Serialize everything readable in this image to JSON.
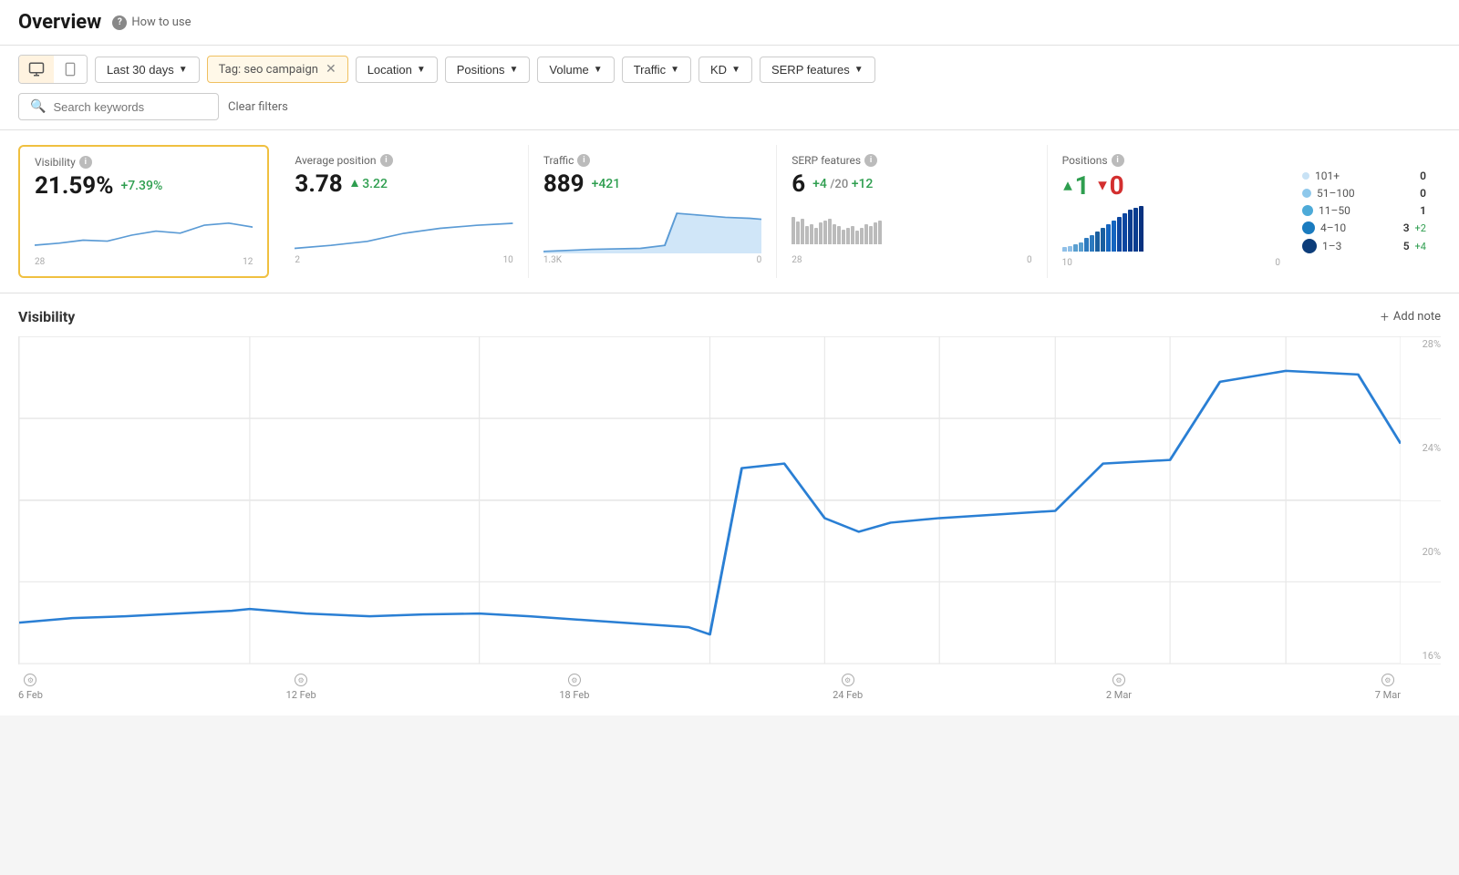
{
  "header": {
    "title": "Overview",
    "help_label": "How to use"
  },
  "toolbar": {
    "date_filter": "Last 30 days",
    "tag_filter": "Tag: seo campaign",
    "location_filter": "Location",
    "positions_filter": "Positions",
    "volume_filter": "Volume",
    "traffic_filter": "Traffic",
    "kd_filter": "KD",
    "serp_filter": "SERP features",
    "search_placeholder": "Search keywords",
    "clear_filters": "Clear filters"
  },
  "metrics": {
    "visibility": {
      "label": "Visibility",
      "value": "21.59%",
      "delta": "+7.39%",
      "y_max": "28",
      "y_min": "12"
    },
    "avg_position": {
      "label": "Average position",
      "value": "3.78",
      "delta": "3.22",
      "y_max": "2",
      "y_min": "10"
    },
    "traffic": {
      "label": "Traffic",
      "value": "889",
      "delta": "+421",
      "y_max": "1.3K",
      "y_min": "0"
    },
    "serp_features": {
      "label": "SERP features",
      "value": "6",
      "delta_plus": "+4",
      "total": "/20",
      "delta_new": "+12",
      "y_max": "28",
      "y_min": "0"
    },
    "positions": {
      "label": "Positions",
      "up": "1",
      "down": "0",
      "y_max": "10",
      "y_min": "0"
    }
  },
  "positions_legend": [
    {
      "range": "101+",
      "count": "0",
      "delta": "",
      "color": "#d0e8f8",
      "size": 8
    },
    {
      "range": "51–100",
      "count": "0",
      "delta": "",
      "color": "#a0cff0",
      "size": 10
    },
    {
      "range": "11–50",
      "count": "1",
      "delta": "",
      "color": "#60aadd",
      "size": 12
    },
    {
      "range": "4–10",
      "count": "3",
      "delta": "+2",
      "delta_color": "#2e9e4f",
      "color": "#1e80c8",
      "size": 14
    },
    {
      "range": "1–3",
      "count": "5",
      "delta": "+4",
      "delta_color": "#2e9e4f",
      "color": "#0d4f8a",
      "size": 16
    }
  ],
  "chart": {
    "title": "Visibility",
    "add_note": "Add note",
    "y_labels": [
      "28%",
      "24%",
      "20%",
      "16%"
    ],
    "x_labels": [
      "6 Feb",
      "12 Feb",
      "18 Feb",
      "24 Feb",
      "2 Mar",
      "7 Mar"
    ]
  }
}
